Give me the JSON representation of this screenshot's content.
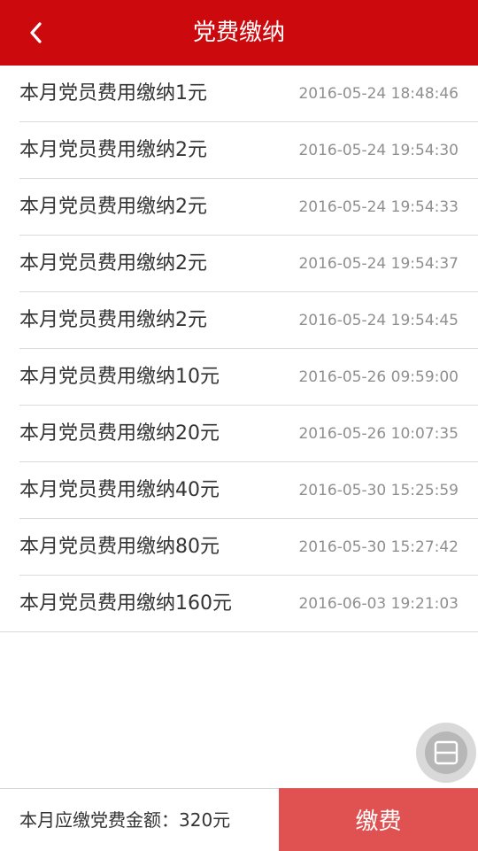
{
  "header": {
    "title": "党费缴纳",
    "back_icon": "chevron-left-icon"
  },
  "records": [
    {
      "label": "本月党员费用缴纳1元",
      "time": "2016-05-24 18:48:46"
    },
    {
      "label": "本月党员费用缴纳2元",
      "time": "2016-05-24 19:54:30"
    },
    {
      "label": "本月党员费用缴纳2元",
      "time": "2016-05-24 19:54:33"
    },
    {
      "label": "本月党员费用缴纳2元",
      "time": "2016-05-24 19:54:37"
    },
    {
      "label": "本月党员费用缴纳2元",
      "time": "2016-05-24 19:54:45"
    },
    {
      "label": "本月党员费用缴纳10元",
      "time": "2016-05-26 09:59:00"
    },
    {
      "label": "本月党员费用缴纳20元",
      "time": "2016-05-26 10:07:35"
    },
    {
      "label": "本月党员费用缴纳40元",
      "time": "2016-05-30 15:25:59"
    },
    {
      "label": "本月党员费用缴纳80元",
      "time": "2016-05-30 15:27:42"
    },
    {
      "label": "本月党员费用缴纳160元",
      "time": "2016-06-03 19:21:03"
    }
  ],
  "floating_button": {
    "icon": "split-window-icon"
  },
  "footer": {
    "amount_text": "本月应缴党费金额：320元",
    "pay_label": "缴费"
  },
  "colors": {
    "header_bg": "#cc0a0e",
    "pay_button_bg": "#e05252"
  }
}
